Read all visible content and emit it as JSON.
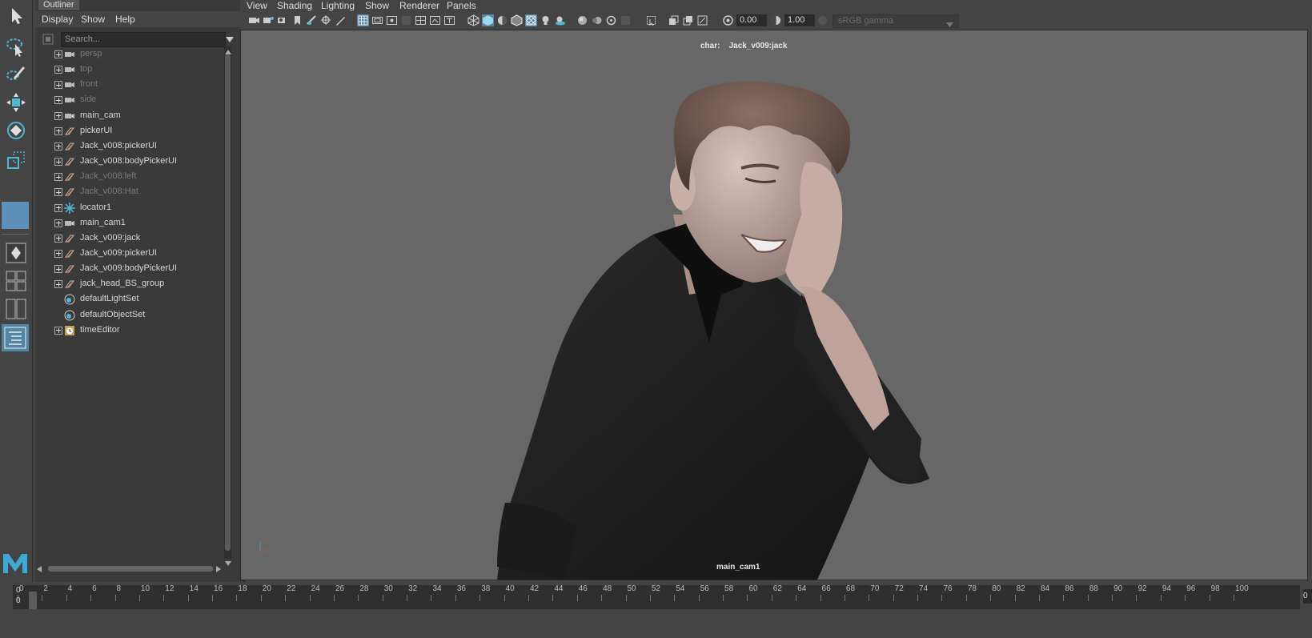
{
  "outliner": {
    "tab_label": "Outliner",
    "menu": [
      "Display",
      "Show",
      "Help"
    ],
    "search_placeholder": "Search...",
    "items": [
      {
        "label": "persp",
        "icon": "camera-icon",
        "state": "dim",
        "expandable": true
      },
      {
        "label": "top",
        "icon": "camera-icon",
        "state": "dim",
        "expandable": true
      },
      {
        "label": "front",
        "icon": "camera-icon",
        "state": "dim",
        "expandable": true
      },
      {
        "label": "side",
        "icon": "camera-icon",
        "state": "dim",
        "expandable": true
      },
      {
        "label": "main_cam",
        "icon": "camera-icon",
        "state": "bright",
        "expandable": true
      },
      {
        "label": "pickerUI",
        "icon": "transform-icon",
        "state": "bright",
        "expandable": true
      },
      {
        "label": "Jack_v008:pickerUI",
        "icon": "transform-icon",
        "state": "bright",
        "expandable": true
      },
      {
        "label": "Jack_v008:bodyPickerUI",
        "icon": "transform-icon",
        "state": "bright",
        "expandable": true
      },
      {
        "label": "Jack_v008:left",
        "icon": "transform-icon",
        "state": "dim",
        "expandable": true
      },
      {
        "label": "Jack_v008:Hat",
        "icon": "transform-icon",
        "state": "dim",
        "expandable": true
      },
      {
        "label": "locator1",
        "icon": "locator-icon",
        "state": "bright",
        "expandable": true
      },
      {
        "label": "main_cam1",
        "icon": "camera-icon",
        "state": "bright",
        "expandable": true
      },
      {
        "label": "Jack_v009:jack",
        "icon": "transform-icon",
        "state": "bright",
        "expandable": true
      },
      {
        "label": "Jack_v009:pickerUI",
        "icon": "transform-icon",
        "state": "bright",
        "expandable": true
      },
      {
        "label": "Jack_v009:bodyPickerUI",
        "icon": "transform-icon",
        "state": "bright",
        "expandable": true
      },
      {
        "label": "jack_head_BS_group",
        "icon": "transform-icon",
        "state": "bright",
        "expandable": true
      },
      {
        "label": "defaultLightSet",
        "icon": "set-icon",
        "state": "bright",
        "expandable": false
      },
      {
        "label": "defaultObjectSet",
        "icon": "set-icon",
        "state": "bright",
        "expandable": false
      },
      {
        "label": "timeEditor",
        "icon": "clock-icon",
        "state": "bright",
        "expandable": true
      }
    ]
  },
  "viewport": {
    "menu": [
      "View",
      "Shading",
      "Lighting",
      "Show",
      "Renderer",
      "Panels"
    ],
    "exposure_value": "0.00",
    "gamma_value": "1.00",
    "color_space": "sRGB gamma",
    "hud_char_label": "char:",
    "hud_char_value": "Jack_v009:jack",
    "camera_name": "main_cam1"
  },
  "timeline": {
    "ticks": [
      "0",
      "2",
      "4",
      "6",
      "8",
      "10",
      "12",
      "14",
      "16",
      "18",
      "20",
      "22",
      "24",
      "26",
      "28",
      "30",
      "32",
      "34",
      "36",
      "38",
      "40",
      "42",
      "44",
      "46",
      "48",
      "50",
      "52",
      "54",
      "56",
      "58",
      "60",
      "62",
      "64",
      "66",
      "68",
      "70",
      "72",
      "74",
      "76",
      "78",
      "80",
      "82",
      "84",
      "86",
      "88",
      "90",
      "92",
      "94",
      "96",
      "98",
      "100"
    ],
    "current_frame_a": "0",
    "current_frame_b": "0",
    "end_value": "0"
  },
  "colors": {
    "accent": "#5285a6",
    "panel_bg": "#444444",
    "viewport_bg": "#676767"
  }
}
